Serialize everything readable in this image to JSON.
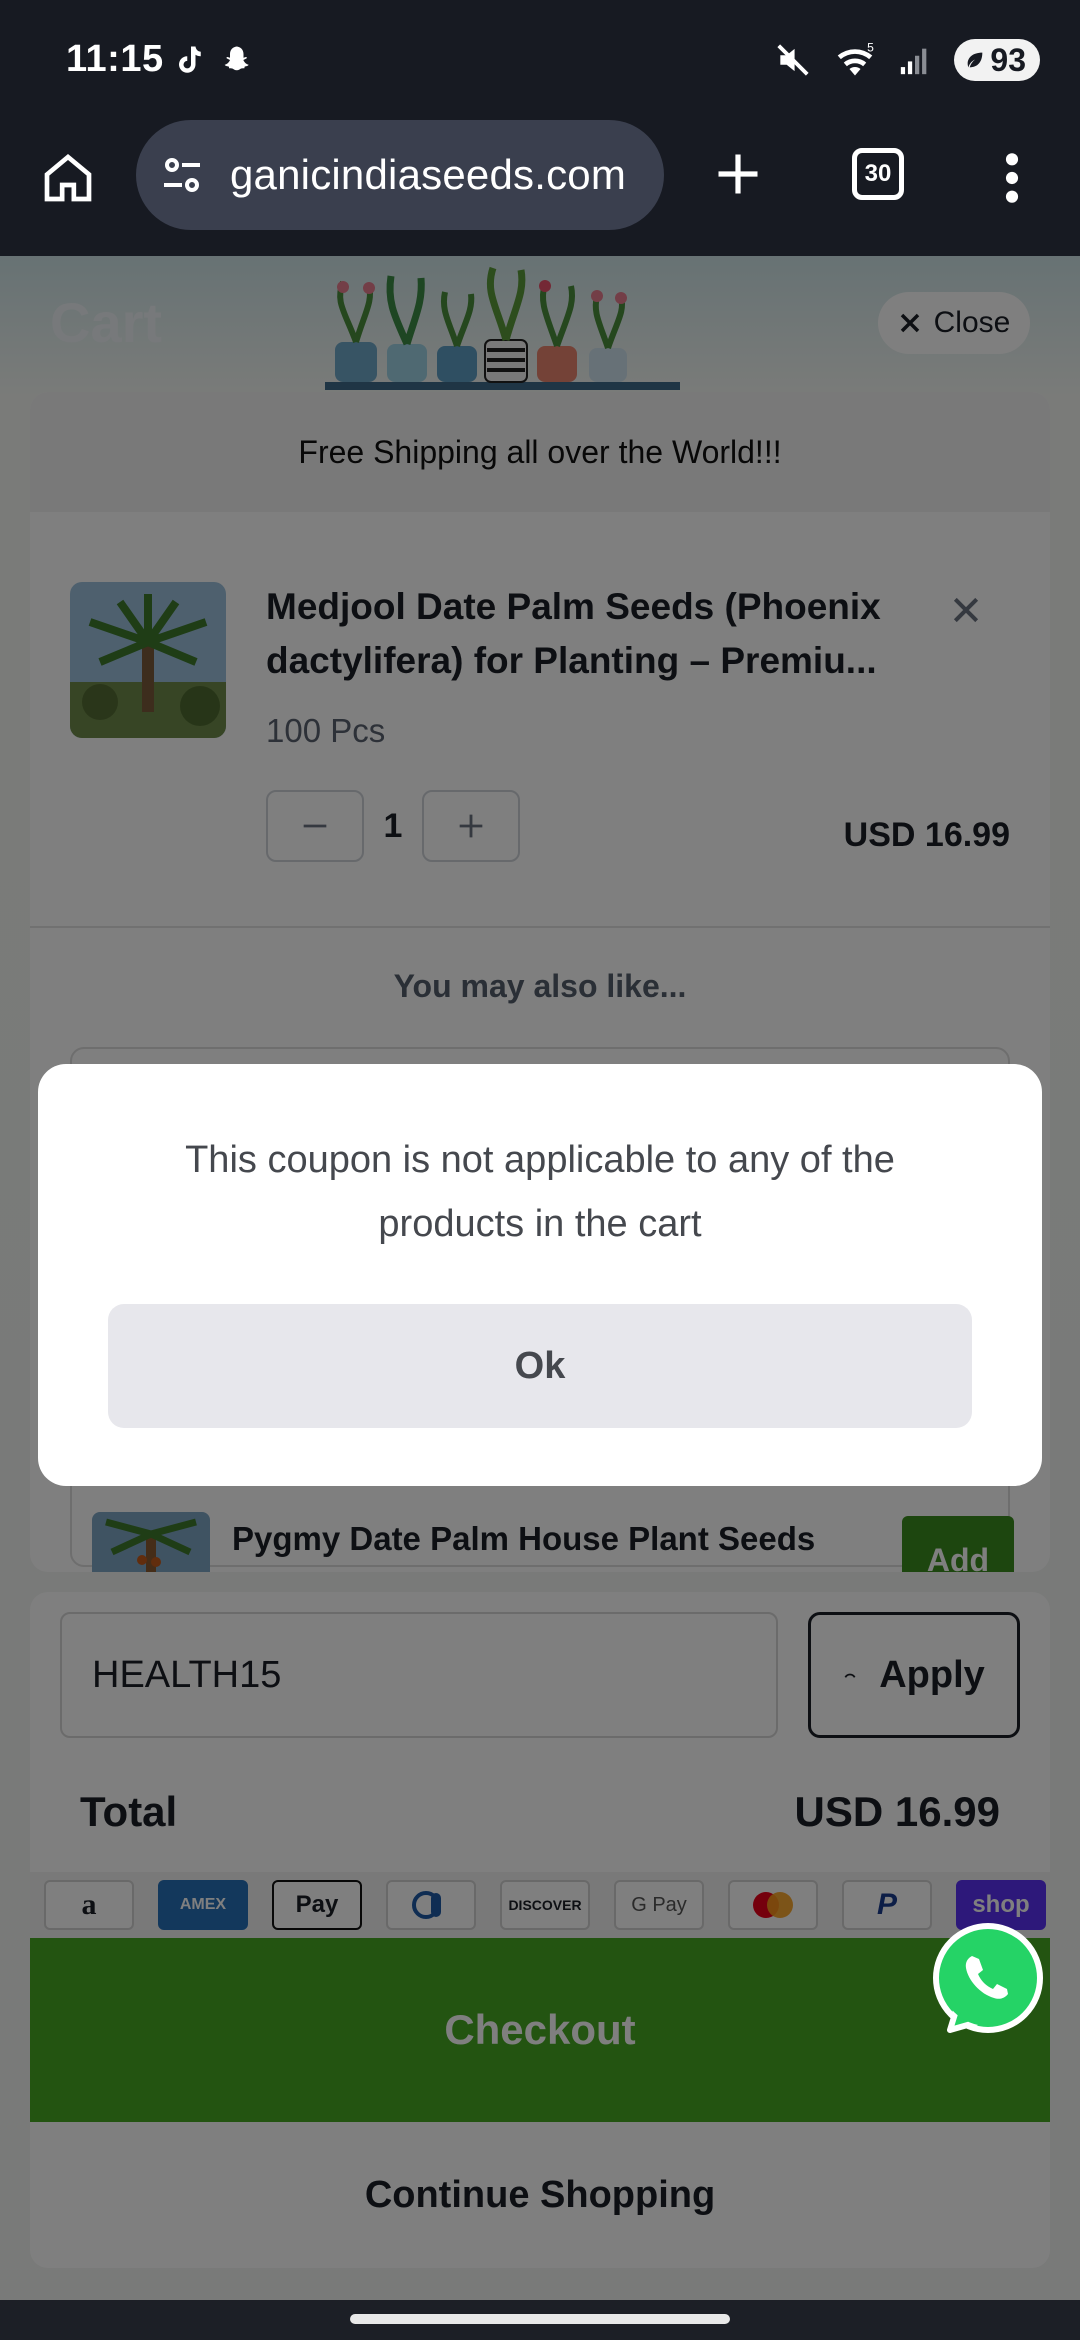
{
  "status_bar": {
    "time": "11:15",
    "battery": "93",
    "icons": [
      "tiktok-icon",
      "snapchat-icon",
      "mute-icon",
      "wifi-icon",
      "signal-icon",
      "battery-icon"
    ]
  },
  "browser": {
    "url": "ganicindiaseeds.com",
    "tab_count": "30"
  },
  "page": {
    "title": "Cart",
    "close_label": "Close",
    "shipping_notice": "Free Shipping all over the World!!!"
  },
  "cart_item": {
    "title": "Medjool Date Palm Seeds (Phoenix dactylifera) for Planting – Premiu...",
    "variant": "100 Pcs",
    "quantity": "1",
    "price": "USD 16.99"
  },
  "recommendations": {
    "heading": "You may also like...",
    "items": [
      {
        "title": "Pygmy Date Palm House Plant Seeds",
        "add_label": "Add"
      }
    ]
  },
  "coupon": {
    "value": "HEALTH15",
    "apply_label": "Apply"
  },
  "total": {
    "label": "Total",
    "value": "USD 16.99"
  },
  "payment_methods": [
    "a",
    "AMEX",
    "Pay",
    "",
    "DISCOVER",
    "G Pay",
    "",
    "P",
    "shop"
  ],
  "checkout_label": "Checkout",
  "continue_label": "Continue Shopping",
  "dialog": {
    "message": "This coupon is not applicable to any of the products in the cart",
    "ok_label": "Ok"
  },
  "colors": {
    "checkout_green": "#46a823",
    "add_green": "#3a8d1e",
    "browser_dark": "#171a22"
  }
}
